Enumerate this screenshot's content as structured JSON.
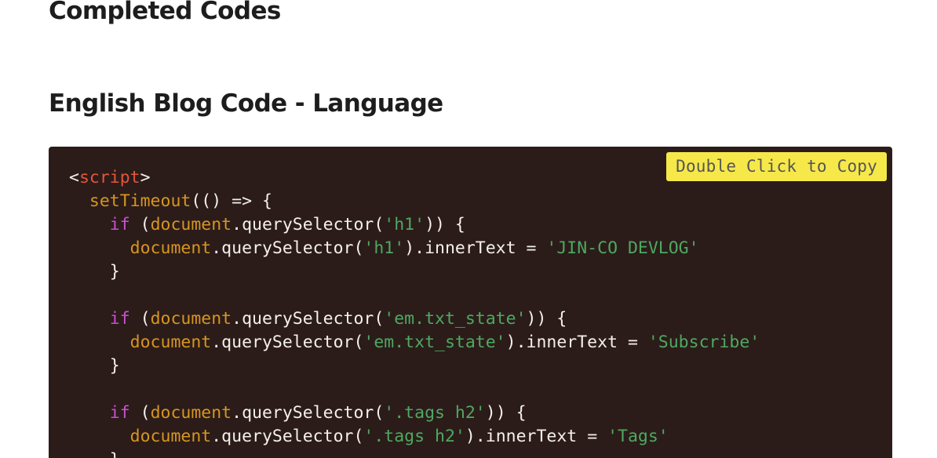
{
  "page": {
    "heading": "Completed Codes",
    "subheading": "English Blog Code - Language"
  },
  "code_block": {
    "copy_label": "Double Click to Copy",
    "lines": {
      "l1_open": "<",
      "l1_tag": "script",
      "l1_close": ">",
      "l2_fn": "setTimeout",
      "l2_rest": "(() => {",
      "l3_kw": "if",
      "l3_p1": " (",
      "l3_obj": "document",
      "l3_p2": ".querySelector(",
      "l3_str": "'h1'",
      "l3_p3": ")) {",
      "l4_obj": "document",
      "l4_p1": ".querySelector(",
      "l4_str1": "'h1'",
      "l4_p2": ").innerText = ",
      "l4_str2": "'JIN-CO DEVLOG'",
      "l5": "}",
      "l7_kw": "if",
      "l7_p1": " (",
      "l7_obj": "document",
      "l7_p2": ".querySelector(",
      "l7_str": "'em.txt_state'",
      "l7_p3": ")) {",
      "l8_obj": "document",
      "l8_p1": ".querySelector(",
      "l8_str1": "'em.txt_state'",
      "l8_p2": ").innerText = ",
      "l8_str2": "'Subscribe'",
      "l9": "}",
      "l11_kw": "if",
      "l11_p1": " (",
      "l11_obj": "document",
      "l11_p2": ".querySelector(",
      "l11_str": "'.tags h2'",
      "l11_p3": ")) {",
      "l12_obj": "document",
      "l12_p1": ".querySelector(",
      "l12_str1": "'.tags h2'",
      "l12_p2": ").innerText = ",
      "l12_str2": "'Tags'",
      "l13": "}"
    }
  },
  "colors": {
    "code_background": "#2b1c1a",
    "copy_button": "#f7e84a",
    "tag": "#e5553b",
    "keyword": "#c84fd1",
    "function": "#d7951f",
    "string": "#4fa860",
    "plain": "#f5f0ec"
  }
}
